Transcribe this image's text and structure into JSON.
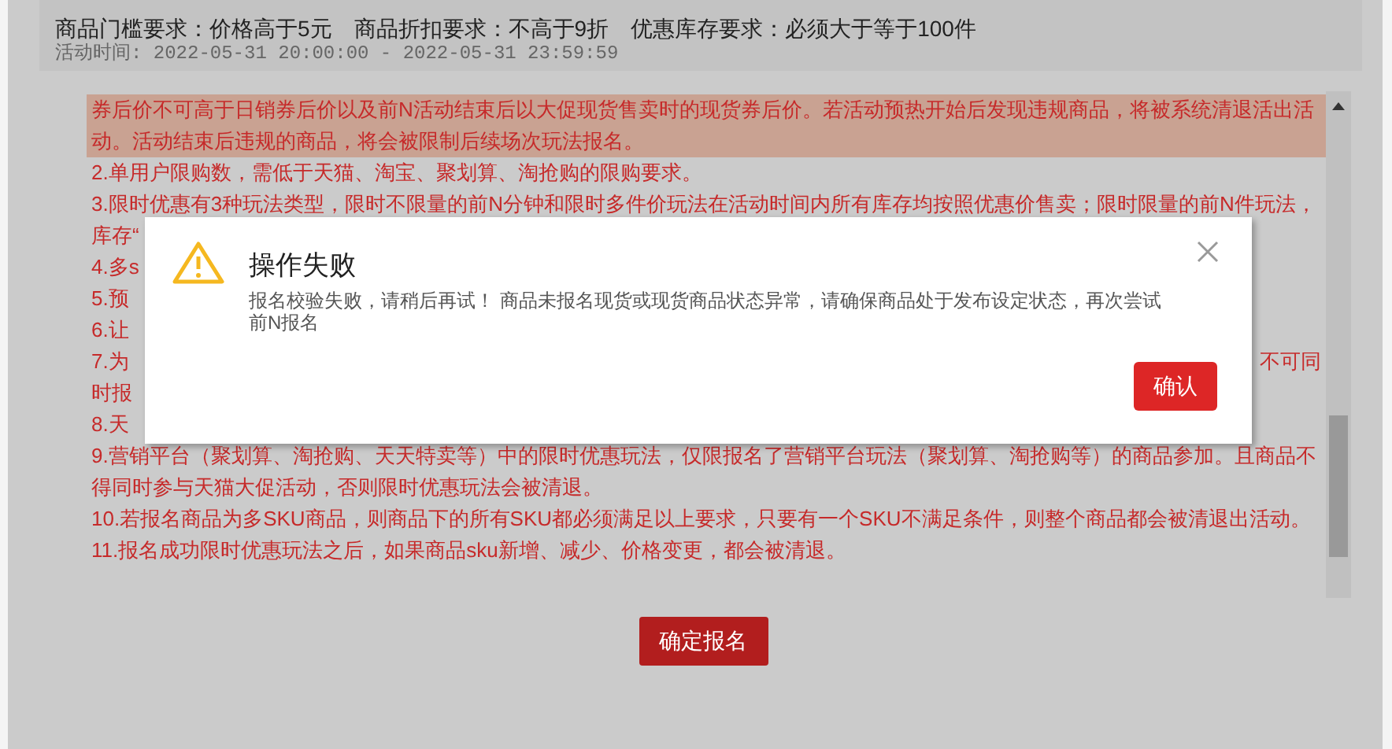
{
  "requirements": {
    "text": "商品门槛要求：价格高于5元　商品折扣要求：不高于9折　优惠库存要求：必须大于等于100件",
    "activity_time": "活动时间: 2022-05-31 20:00:00 - 2022-05-31 23:59:59"
  },
  "rules": [
    {
      "left": "券后价不可高于日销券后价以及前N活动结束后以大促现货售卖时的现货券后价。若活动预热开始后发现违规商品，将被系统清退活出活",
      "highlighted": true
    },
    {
      "left": "动。活动结束后违规的商品，将会被限制后续场次玩法报名。",
      "highlighted": true
    },
    {
      "left": "2.单用户限购数，需低于天猫、淘宝、聚划算、淘抢购的限购要求。",
      "highlighted": false
    },
    {
      "left": "3.限时优惠有3种玩法类型，限时不限量的前N分钟和限时多件价玩法在活动时间内所有库存均按照优惠价售卖；限时限量的前N件玩法，",
      "highlighted": false
    },
    {
      "left": "库存“",
      "highlighted": false
    },
    {
      "left": "4.多s",
      "highlighted": false
    },
    {
      "left": "5.预",
      "highlighted": false
    },
    {
      "left": "6.让",
      "highlighted": false
    },
    {
      "left": "7.为",
      "right": "不可同",
      "highlighted": false
    },
    {
      "left": "时报",
      "highlighted": false
    },
    {
      "left": "8.天",
      "highlighted": false
    },
    {
      "left": "9.营销平台（聚划算、淘抢购、天天特卖等）中的限时优惠玩法，仅限报名了营销平台玩法（聚划算、淘抢购等）的商品参加。且商品不",
      "highlighted": false
    },
    {
      "left": "得同时参与天猫大促活动，否则限时优惠玩法会被清退。",
      "highlighted": false
    },
    {
      "left": "10.若报名商品为多SKU商品，则商品下的所有SKU都必须满足以上要求，只要有一个SKU不满足条件，则整个商品都会被清退出活动。",
      "highlighted": false
    },
    {
      "left": "11.报名成功限时优惠玩法之后，如果商品sku新增、减少、价格变更，都会被清退。",
      "highlighted": false
    }
  ],
  "submit_button": "确定报名",
  "dialog": {
    "title": "操作失败",
    "message": "报名校验失败，请稍后再试！ 商品未报名现货或现货商品状态异常，请确保商品处于发布设定状态，再次尝试前N报名",
    "confirm_button": "确认"
  }
}
